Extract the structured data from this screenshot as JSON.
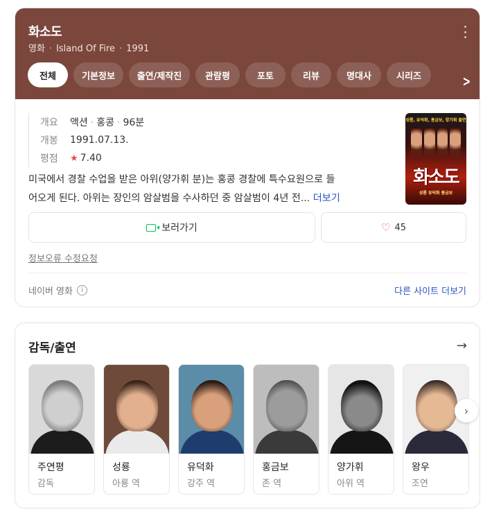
{
  "header": {
    "title": "화소도",
    "subtitle": {
      "type": "영화",
      "english_title": "Island Of Fire",
      "year": "1991"
    },
    "bg_color": "#7b463c",
    "tabs": [
      {
        "label": "전체",
        "active": true
      },
      {
        "label": "기본정보"
      },
      {
        "label": "출연/제작진"
      },
      {
        "label": "관람평"
      },
      {
        "label": "포토"
      },
      {
        "label": "리뷰"
      },
      {
        "label": "명대사"
      },
      {
        "label": "시리즈"
      }
    ]
  },
  "info": {
    "genre_label": "개요",
    "genre": "액션",
    "country": "홍콩",
    "runtime": "96분",
    "release_label": "개봉",
    "release": "1991.07.13.",
    "rating_label": "평점",
    "rating": "7.40"
  },
  "poster": {
    "top_text": "성룡, 유덕화, 홍금보, 양가휘 출연",
    "title_text": "화소도",
    "bottom_text": "성룡 유덕화 홍금보"
  },
  "synopsis": {
    "line1": "미국에서 경찰 수업을 받은 아위(양가휘 분)는 홍콩 경찰에 특수요원으로 들",
    "line2": "어오게 된다. 아위는 장인의 암살범을 수사하던 중 암살범이 4년 전...",
    "more": "더보기"
  },
  "actions": {
    "watch_label": "보러가기",
    "like_count": "45"
  },
  "report_label": "정보오류 수정요청",
  "source": {
    "label": "네이버 영화",
    "other_sites": "다른 사이트 더보기"
  },
  "cast": {
    "title": "감독/출연",
    "people": [
      {
        "name": "주연평",
        "role": "감독"
      },
      {
        "name": "성룡",
        "role": "아룡 역"
      },
      {
        "name": "유덕화",
        "role": "강주 역"
      },
      {
        "name": "홍금보",
        "role": "존 역"
      },
      {
        "name": "양가휘",
        "role": "아위 역"
      },
      {
        "name": "왕우",
        "role": "조연"
      }
    ]
  }
}
